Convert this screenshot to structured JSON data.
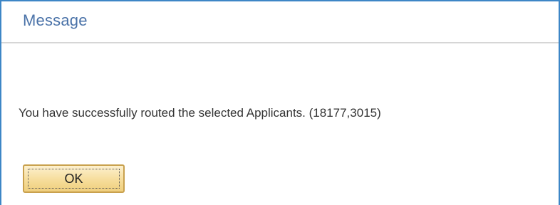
{
  "dialog": {
    "title": "Message",
    "message": "You have successfully routed the selected Applicants. (18177,3015)",
    "ok_label": "OK"
  },
  "colors": {
    "border": "#3d86c6",
    "title_text": "#4a72a8",
    "button_fill": "#f6dd9b",
    "button_border": "#c9a14e"
  }
}
